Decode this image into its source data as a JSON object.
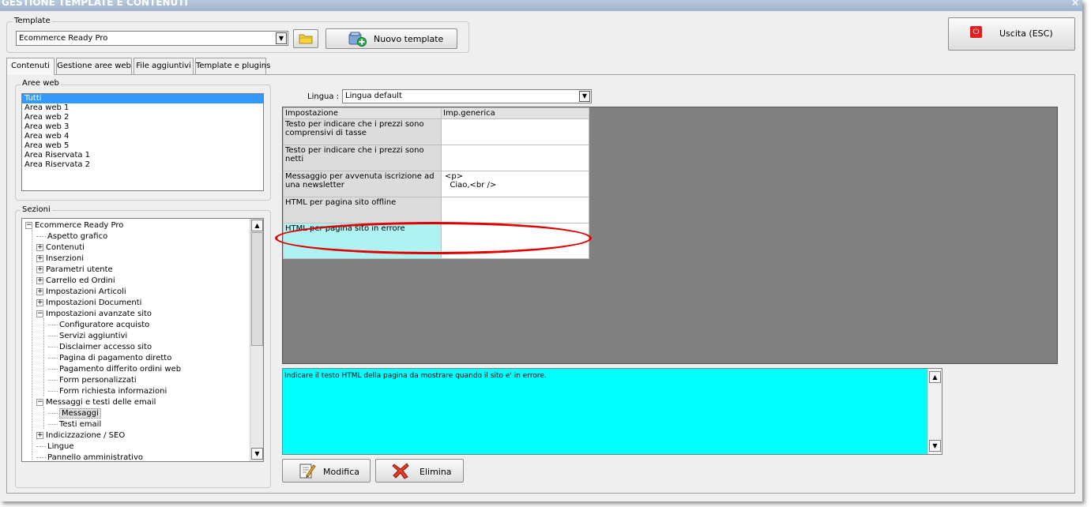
{
  "window": {
    "title": "GESTIONE TEMPLATE E CONTENUTI",
    "close_glyph": "×"
  },
  "template_group": {
    "label": "Template",
    "selected": "Ecommerce Ready Pro",
    "new_template_label": "Nuovo template"
  },
  "exit_button": {
    "label": "Uscita (ESC)",
    "icon": "power-icon",
    "icon_color": "#e02020",
    "icon_glyph": "⏻"
  },
  "tabs": [
    {
      "label": "Contenuti",
      "active": true
    },
    {
      "label": "Gestione aree web",
      "active": false
    },
    {
      "label": "File aggiuntivi",
      "active": false
    },
    {
      "label": "Template e plugins",
      "active": false
    }
  ],
  "aree_web": {
    "label": "Aree web",
    "items": [
      "Tutti",
      "Area web 1",
      "Area web 2",
      "Area web 3",
      "Area web 4",
      "Area web 5",
      "Area Riservata 1",
      "Area Riservata 2"
    ],
    "selected_index": 0
  },
  "sezioni": {
    "label": "Sezioni",
    "tree": [
      {
        "label": "Ecommerce Ready Pro",
        "level": 0,
        "expander": "−"
      },
      {
        "label": "Aspetto grafico",
        "level": 1,
        "expander": ""
      },
      {
        "label": "Contenuti",
        "level": 1,
        "expander": "+"
      },
      {
        "label": "Inserzioni",
        "level": 1,
        "expander": "+"
      },
      {
        "label": "Parametri utente",
        "level": 1,
        "expander": "+"
      },
      {
        "label": "Carrello ed Ordini",
        "level": 1,
        "expander": "+"
      },
      {
        "label": "Impostazioni Articoli",
        "level": 1,
        "expander": "+"
      },
      {
        "label": "Impostazioni Documenti",
        "level": 1,
        "expander": "+"
      },
      {
        "label": "Impostazioni avanzate sito",
        "level": 1,
        "expander": "−"
      },
      {
        "label": "Configuratore acquisto",
        "level": 2,
        "expander": ""
      },
      {
        "label": "Servizi aggiuntivi",
        "level": 2,
        "expander": ""
      },
      {
        "label": "Disclaimer accesso sito",
        "level": 2,
        "expander": ""
      },
      {
        "label": "Pagina di pagamento diretto",
        "level": 2,
        "expander": ""
      },
      {
        "label": "Pagamento differito ordini web",
        "level": 2,
        "expander": ""
      },
      {
        "label": "Form personalizzati",
        "level": 2,
        "expander": ""
      },
      {
        "label": "Form richiesta informazioni",
        "level": 2,
        "expander": ""
      },
      {
        "label": "Messaggi e testi delle email",
        "level": 1,
        "expander": "−"
      },
      {
        "label": "Messaggi",
        "level": 2,
        "expander": "",
        "selected": true
      },
      {
        "label": "Testi email",
        "level": 2,
        "expander": ""
      },
      {
        "label": "Indicizzazione / SEO",
        "level": 1,
        "expander": "+"
      },
      {
        "label": "Lingue",
        "level": 1,
        "expander": ""
      },
      {
        "label": "Pannello amministrativo",
        "level": 1,
        "expander": ""
      }
    ]
  },
  "lingua": {
    "label": "Lingua :",
    "selected": "Lingua default"
  },
  "grid": {
    "headers": [
      "Impostazione",
      "Imp.generica"
    ],
    "rows": [
      {
        "setting": "Testo per indicare che i prezzi sono comprensivi di tasse",
        "value": "",
        "selected": false
      },
      {
        "setting": "Testo per indicare che i prezzi sono netti",
        "value": "",
        "selected": false
      },
      {
        "setting": "Messaggio per avvenuta iscrizione ad una newsletter",
        "value": "<p>\n  Ciao,<br />",
        "selected": false
      },
      {
        "setting": "HTML per pagina sito offline",
        "value": "",
        "selected": false
      },
      {
        "setting": "HTML per pagina sito in errore",
        "value": "",
        "selected": true
      }
    ]
  },
  "description": {
    "text": "Indicare il testo HTML della pagina da mostrare quando il sito e' in errore."
  },
  "actions": {
    "modify_label": "Modifica",
    "delete_label": "Elimina"
  },
  "colors": {
    "highlight_ellipse": "#e00000",
    "description_bg": "#00ffff",
    "selected_cell": "#aff2f2",
    "list_selection": "#3399ff"
  }
}
